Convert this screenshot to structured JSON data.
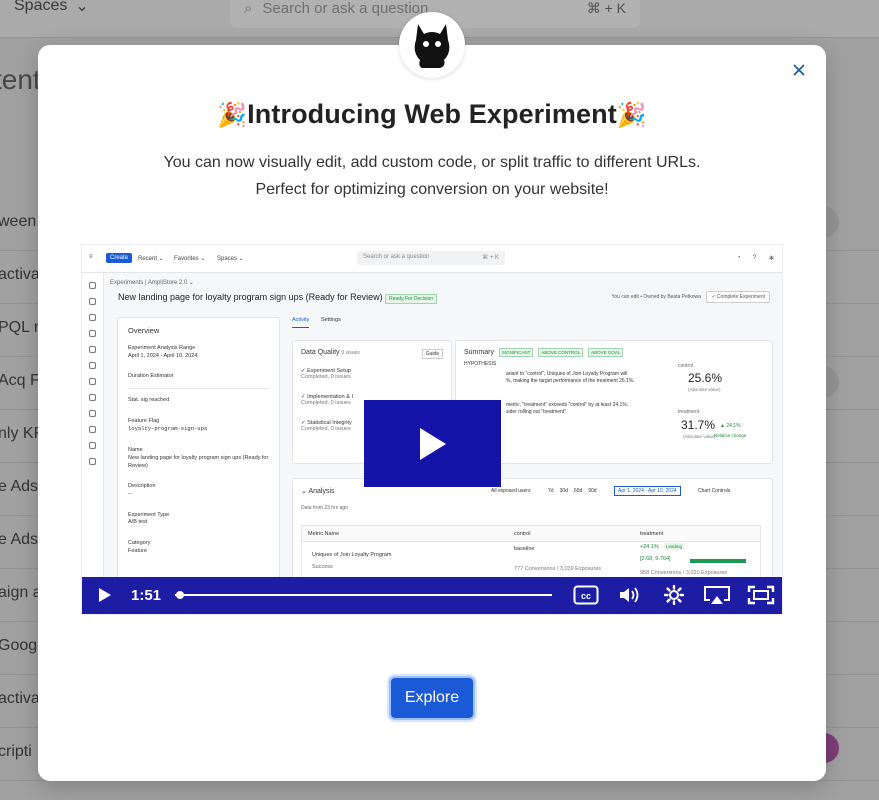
{
  "background": {
    "spaces_label": "Spaces",
    "search_placeholder": "Search or ask a question",
    "search_shortcut": "⌘ + K",
    "page_title": "tent",
    "rows": [
      "ween",
      "activa",
      "PQL re",
      "Acq F",
      "nly KF",
      "e Ads",
      "e Ads",
      "aign a",
      "Goog",
      "activa",
      "cripti"
    ]
  },
  "modal": {
    "title": "Introducing Web Experiment",
    "title_emoji": "🎉",
    "subtitle_line1": "You can now visually edit, add custom code, or split traffic to different URLs.",
    "subtitle_line2": "Perfect for optimizing conversion on your website!",
    "explore_label": "Explore",
    "close_icon": "×"
  },
  "video": {
    "time": "1:51",
    "progress_fraction": 0.01,
    "screen": {
      "create": "Create",
      "menu": [
        "Recent ⌄",
        "Favorites ⌄",
        "Spaces ⌄"
      ],
      "search": "Search or ask a question",
      "shortcut": "⌘ + K",
      "breadcrumb": "Experiments  |  AmpliStore 2.0 ⌄",
      "title": "New landing page for loyalty program sign ups (Ready for Review)",
      "title_tag": "Ready For Decision",
      "owner": "You can edit • Owned by Beata Petkowa",
      "complete": "✓ Complete Experiment",
      "overview": {
        "heading": "Overview",
        "range_label": "Experiment Analysis Range",
        "range_value": "April 1, 2024 - April 10, 2024",
        "duration": "Duration Estimator",
        "stat": "Stat. sig reached",
        "flag_label": "Feature Flag",
        "flag_value": "loyalty-program-sign-ups",
        "name_label": "Name",
        "name_value": "New landing page for loyalty program sign ups (Ready for Review)",
        "desc_label": "Description",
        "desc_value": "--",
        "type_label": "Experiment Type",
        "type_value": "A/B test",
        "cat_label": "Category",
        "cat_value": "Feature"
      },
      "tabs": [
        "Activity",
        "Settings"
      ],
      "dq": {
        "heading": "Data Quality",
        "issues": "0 issues",
        "guide": "Guide",
        "items": [
          "✓ Experiment Setup",
          "✓ Implementation & I",
          "✓ Statistical Integrity"
        ],
        "completed": "Completed, 0 issues"
      },
      "summary": {
        "heading": "Summary",
        "chips": [
          "SIGNIFICANT",
          "ABOVE CONTROL",
          "ABOVE GOAL"
        ],
        "hypothesis": "HYPOTHESIS",
        "line1": "ariant to \"control\", Uniques of Join Loyalty Program will",
        "line2": "%, making the target performance of the treatment 26.1%.",
        "line3": "metric, \"treatment\" exceeds \"control\" by at least 24.1%.",
        "line4": "sider rolling out \"treatment\".",
        "control_label": "control",
        "control_value": "25.6%",
        "treatment_label": "treatment",
        "treatment_value": "31.7%",
        "abs": "(Absolute value)",
        "rel": "▲ 24.1%",
        "rel_label": "Relative change"
      },
      "analysis": {
        "heading": "Analysis",
        "all_users": "All exposed users",
        "ranges": [
          "7d",
          "30d",
          "60d",
          "90d"
        ],
        "date": "Apr 1, 2024 - Apr 10, 2024",
        "chart_controls": "Chart Controls",
        "data_from": "Data from 23 hrs ago",
        "cols": [
          "Metric Name",
          "control",
          "treatment"
        ],
        "metric": "Uniques of Join Loyalty Program",
        "success": "Success",
        "baseline": "baseline",
        "control_conv": "777 Conversions / 3,039 Exposures",
        "treatment_lift": "+24.1%",
        "leading": "Leading",
        "ci": "[2.68, 9.764]",
        "treatment_conv": "958 Conversions / 3,020 Exposures"
      }
    }
  },
  "colors": {
    "accent": "#1b5ad6",
    "video_bar": "#1d1da4",
    "play_box": "#1414a8"
  }
}
